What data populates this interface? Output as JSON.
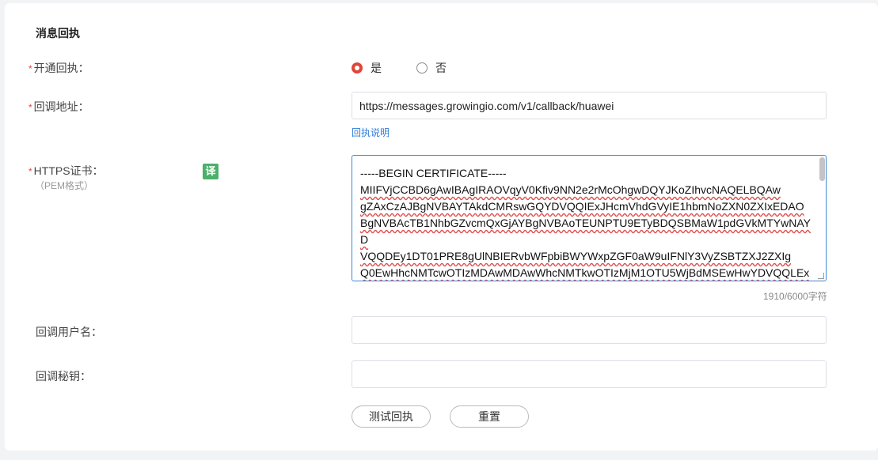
{
  "section": {
    "title": "消息回执"
  },
  "fields": {
    "enable": {
      "label": "开通回执：",
      "required_mark": "*",
      "options": [
        "是",
        "否"
      ],
      "selected": "是"
    },
    "callback_url": {
      "label": "回调地址：",
      "required_mark": "*",
      "value": "https://messages.growingio.com/v1/callback/huawei",
      "link": "回执说明"
    },
    "cert": {
      "label": "HTTPS证书：",
      "required_mark": "*",
      "sublabel": "（PEM格式）",
      "translate_badge": "译",
      "lines": [
        "-----BEGIN CERTIFICATE-----",
        "MIIFVjCCBD6gAwIBAgIRAOVqyV0Kfiv9NN2e2rMcOhgwDQYJKoZIhvcNAQELBQAw",
        "gZAxCzAJBgNVBAYTAkdCMRswGQYDVQQIExJHcmVhdGVyIE1hbmNoZXN0ZXIxEDAO",
        "BgNVBAcTB1NhbGZvcmQxGjAYBgNVBAoTEUNPTU9ETyBDQSBMaW1pdGVkMTYwNAYD",
        "VQQDEy1DT01PRE8gUlNBIERvbWFpbiBWYWxpZGF0aW9uIFNlY3VyZSBTZXJ2ZXIg",
        "Q0EwHhcNMTcwOTIzMDAwMDAwWhcNMTkwOTIzMjM1OTU5WjBdMSEwHwYDVQQLEx"
      ],
      "counter": "1910/6000字符"
    },
    "username": {
      "label": "回调用户名：",
      "value": ""
    },
    "secret": {
      "label": "回调秘钥：",
      "value": ""
    }
  },
  "actions": {
    "test": "测试回执",
    "reset": "重置"
  },
  "colors": {
    "accent": "#e0453a",
    "link": "#2f7bd9",
    "focus_border": "#3a8ad8",
    "badge": "#4caf6a"
  }
}
